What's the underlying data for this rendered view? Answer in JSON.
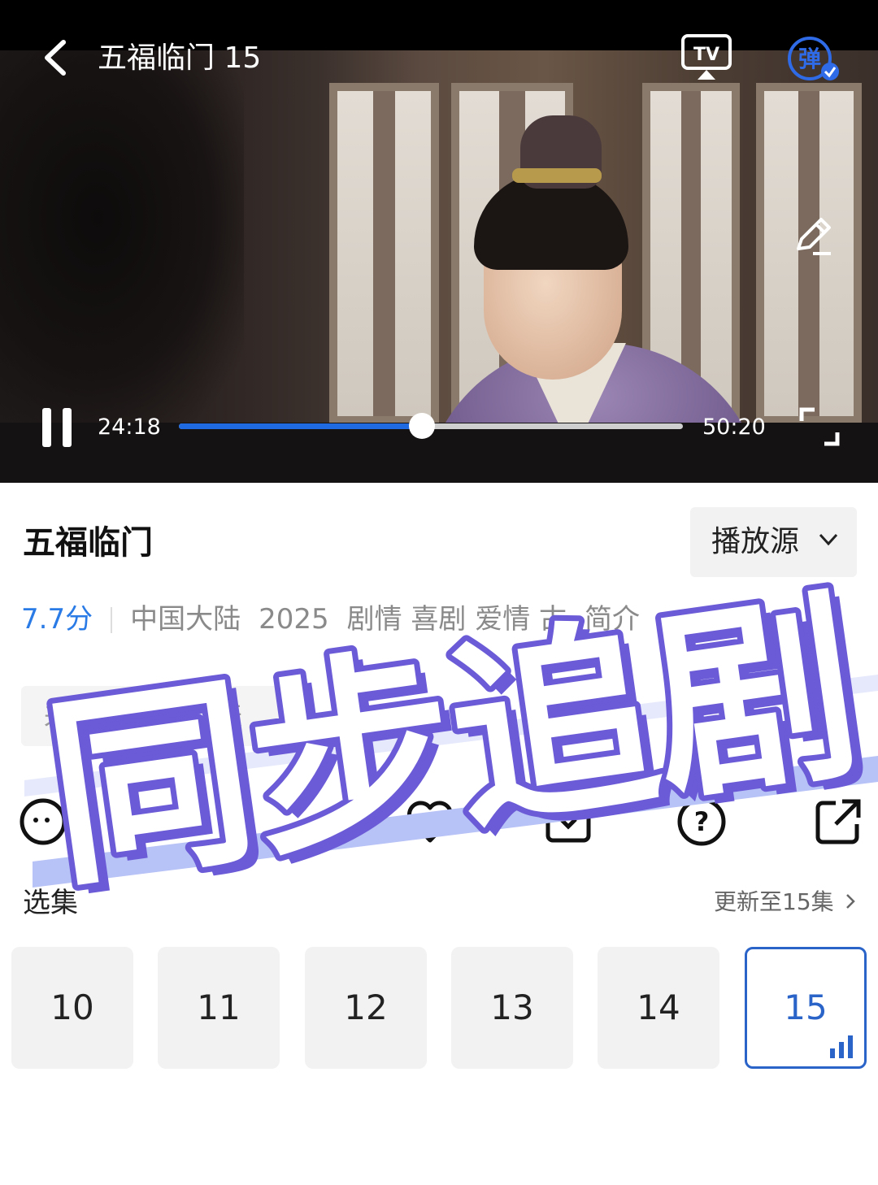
{
  "player": {
    "title": "五福临门 15",
    "current_time": "24:18",
    "total_time": "50:20",
    "progress": 0.482,
    "icons": [
      "back-icon",
      "tv-cast-icon",
      "danmu-icon",
      "edit-icon",
      "pause-icon",
      "fullscreen-icon"
    ],
    "accent_color": "#1f6ae0"
  },
  "show": {
    "title": "五福临门",
    "source_label": "播放源",
    "rating": "7.7分",
    "region": "中国大陆",
    "year": "2025",
    "genres": "剧情 喜剧 爱情 古",
    "intro_fragment": "简介",
    "rating_color": "#2a7be6"
  },
  "comment": {
    "placeholder_fragment": "来",
    "placeholder_tail": "天"
  },
  "actions": {
    "icons": [
      "share-wechat-icon",
      "like-heart-icon",
      "download-icon",
      "help-icon",
      "external-share-icon"
    ]
  },
  "episodes": {
    "label": "选集",
    "update_text": "更新至15集",
    "items": [
      "10",
      "11",
      "12",
      "13",
      "14",
      "15"
    ],
    "active": "15",
    "active_color": "#2a64c9"
  },
  "banner": {
    "text": "同步追剧",
    "colors": {
      "fill": "#ffffff",
      "outline": "#6b5bd6",
      "stripe": "#a9b6f5"
    }
  }
}
